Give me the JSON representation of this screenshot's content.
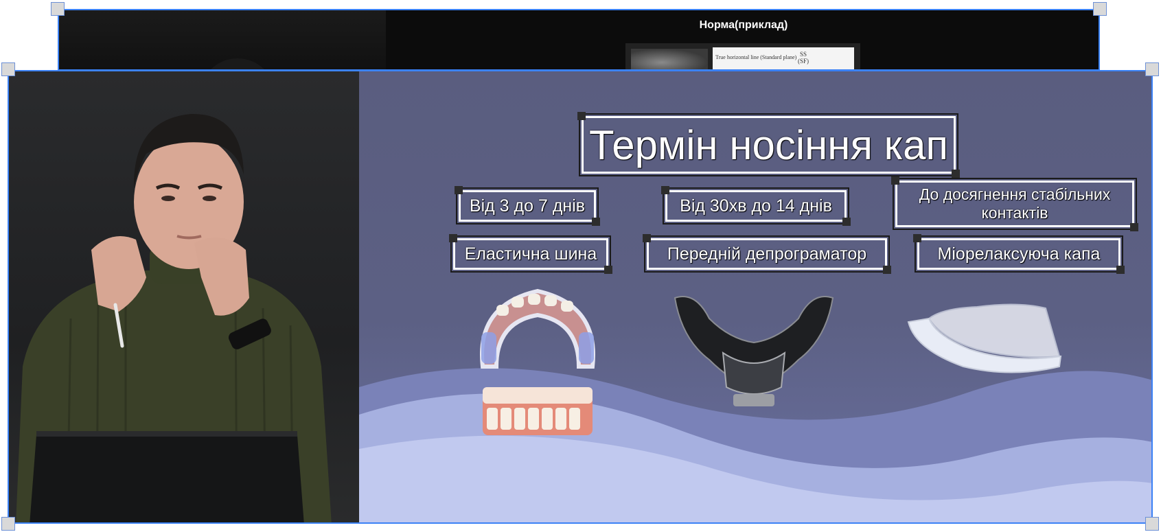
{
  "back_window": {
    "title": "Норма(приклад)",
    "diagram_line": "True horizontal line (Standard plane)",
    "diagram_label_1": "SS",
    "diagram_label_2": "(SF)"
  },
  "slide": {
    "title": "Термін носіння кап",
    "durations": [
      "Від 3 до 7 днів",
      "Від 30хв до 14 днів",
      "До досягнення стабільних контактів"
    ],
    "types": [
      "Еластична шина",
      "Передній депрограматор",
      "Міорелаксуюча капа"
    ]
  },
  "colors": {
    "selection": "#3b82f6",
    "slide_bg": "#5b5f80",
    "wave_light": "#b9c2ea"
  }
}
